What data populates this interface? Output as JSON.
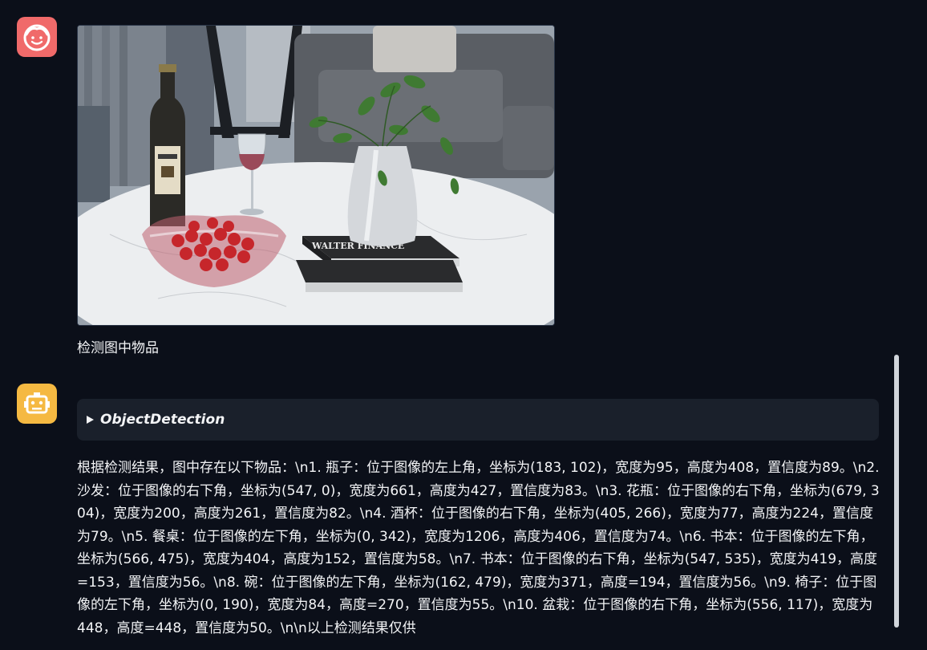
{
  "messages": {
    "user": {
      "avatar_icon": "smiling-face-icon",
      "image_alt": "living room photo with a round marble coffee table, a wine bottle, a wine glass, a bowl of cherry tomatoes, a white vase with green plant, stacked books and a gray sofa",
      "text": "检测图中物品"
    },
    "bot": {
      "avatar_icon": "robot-face-icon",
      "tool_name": "ObjectDetection",
      "text": "根据检测结果，图中存在以下物品：\\n1. 瓶子：位于图像的左上角，坐标为(183, 102)，宽度为95，高度为408，置信度为89。\\n2. 沙发：位于图像的右下角，坐标为(547, 0)，宽度为661，高度为427，置信度为83。\\n3. 花瓶：位于图像的右下角，坐标为(679, 304)，宽度为200，高度为261，置信度为82。\\n4. 酒杯：位于图像的右下角，坐标为(405, 266)，宽度为77，高度为224，置信度为79。\\n5. 餐桌：位于图像的左下角，坐标为(0, 342)，宽度为1206，高度为406，置信度为74。\\n6. 书本：位于图像的左下角，坐标为(566, 475)，宽度为404，高度为152，置信度为58。\\n7. 书本：位于图像的右下角，坐标为(547, 535)，宽度为419，高度=153，置信度为56。\\n8. 碗：位于图像的左下角，坐标为(162, 479)，宽度为371，高度=194，置信度为56。\\n9. 椅子：位于图像的左下角，坐标为(0, 190)，宽度为84，高度=270，置信度为55。\\n10. 盆栽：位于图像的右下角，坐标为(556, 117)，宽度为448，高度=448，置信度为50。\\n\\n以上检测结果仅供"
    }
  },
  "photo_text": {
    "book_title": "WALTER FINANCE"
  },
  "colors": {
    "background": "#0b0f19",
    "user_avatar": "#f06a6a",
    "bot_avatar": "#f5b942",
    "tool_box": "#1a202b"
  }
}
